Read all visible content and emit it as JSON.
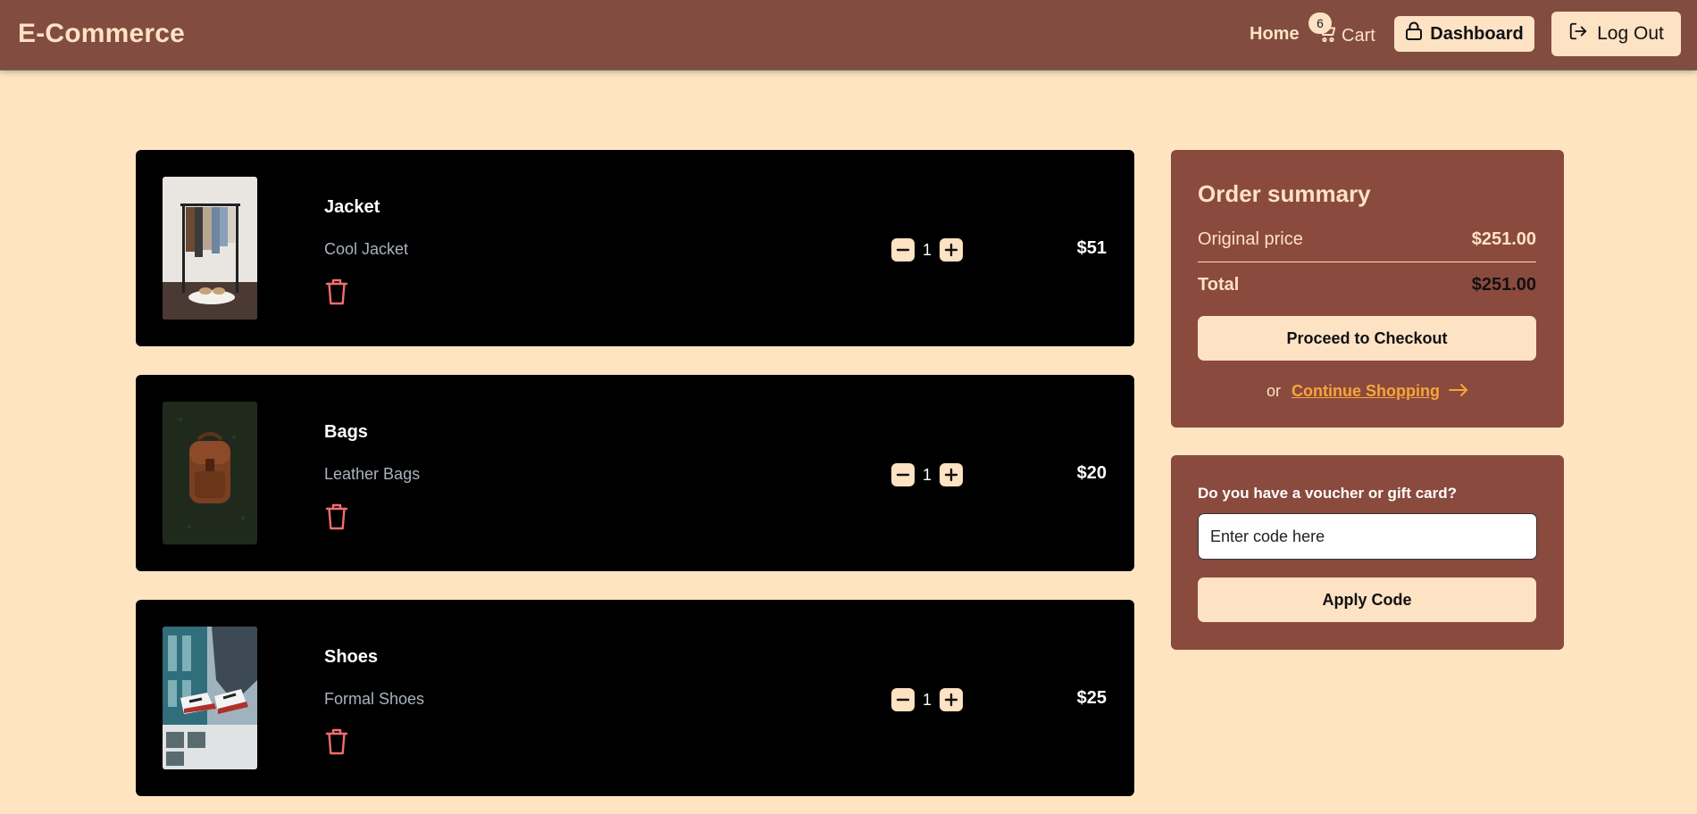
{
  "header": {
    "brand": "E-Commerce",
    "nav": {
      "home": "Home",
      "cart": "Cart",
      "cart_count": "6",
      "dashboard": "Dashboard",
      "logout": "Log Out"
    }
  },
  "cart": {
    "items": [
      {
        "name": "Jacket",
        "description": "Cool Jacket",
        "quantity": "1",
        "price": "$51",
        "image": "clothes-rack-photo"
      },
      {
        "name": "Bags",
        "description": "Leather Bags",
        "quantity": "1",
        "price": "$20",
        "image": "leather-backpack-photo"
      },
      {
        "name": "Shoes",
        "description": "Formal Shoes",
        "quantity": "1",
        "price": "$25",
        "image": "sneakers-photo"
      }
    ]
  },
  "summary": {
    "title": "Order summary",
    "original_label": "Original price",
    "original_value": "$251.00",
    "total_label": "Total",
    "total_value": "$251.00",
    "checkout_label": "Proceed to Checkout",
    "or_text": "or",
    "continue_label": "Continue Shopping"
  },
  "voucher": {
    "label": "Do you have a voucher or gift card?",
    "placeholder": "Enter code here",
    "apply_label": "Apply Code"
  },
  "colors": {
    "header_bg": "#824c40",
    "page_bg": "#ffe4c2",
    "panel_bg": "#8a4a3e",
    "accent": "#fde2c4",
    "trash": "#f26d6d",
    "link": "#f6a53b"
  }
}
